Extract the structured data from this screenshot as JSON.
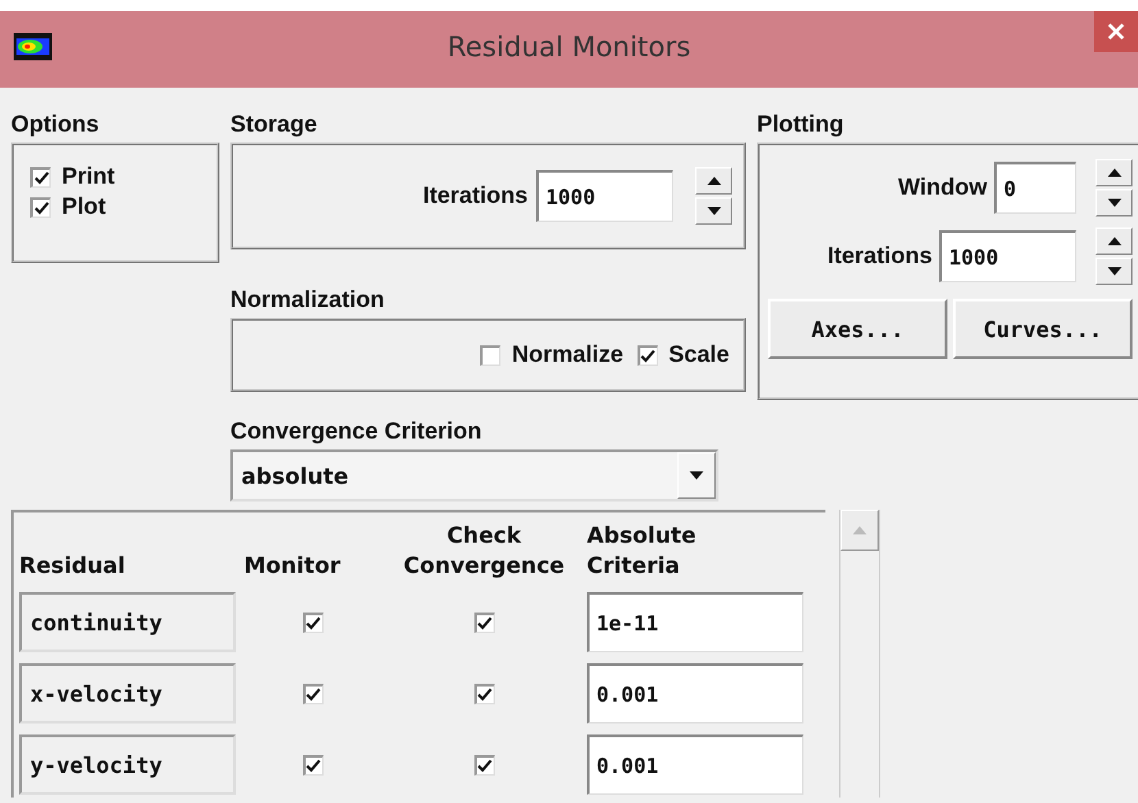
{
  "window": {
    "title": "Residual Monitors"
  },
  "options": {
    "label": "Options",
    "items": [
      {
        "label": "Print",
        "checked": true
      },
      {
        "label": "Plot",
        "checked": true
      }
    ]
  },
  "storage": {
    "label": "Storage",
    "field_label": "Iterations",
    "value": "1000"
  },
  "normalization": {
    "label": "Normalization",
    "items": [
      {
        "label": "Normalize",
        "checked": false
      },
      {
        "label": "Scale",
        "checked": true
      }
    ]
  },
  "convergence_criterion": {
    "label": "Convergence Criterion",
    "value": "absolute"
  },
  "plotting": {
    "label": "Plotting",
    "fields": [
      {
        "label": "Window",
        "value": "0"
      },
      {
        "label": "Iterations",
        "value": "1000"
      }
    ],
    "buttons": [
      "Axes...",
      "Curves..."
    ]
  },
  "table": {
    "columns": [
      {
        "line_2": "Residual"
      },
      {
        "line_2": "Monitor"
      },
      {
        "line_1": "Check",
        "line_2": "Convergence"
      },
      {
        "line_1": "Absolute",
        "line_2": "Criteria"
      }
    ],
    "rows": [
      {
        "residual": "continuity",
        "monitor": true,
        "check_convergence": true,
        "criteria": "1e-11"
      },
      {
        "residual": "x-velocity",
        "monitor": true,
        "check_convergence": true,
        "criteria": "0.001"
      },
      {
        "residual": "y-velocity",
        "monitor": true,
        "check_convergence": true,
        "criteria": "0.001"
      }
    ]
  }
}
